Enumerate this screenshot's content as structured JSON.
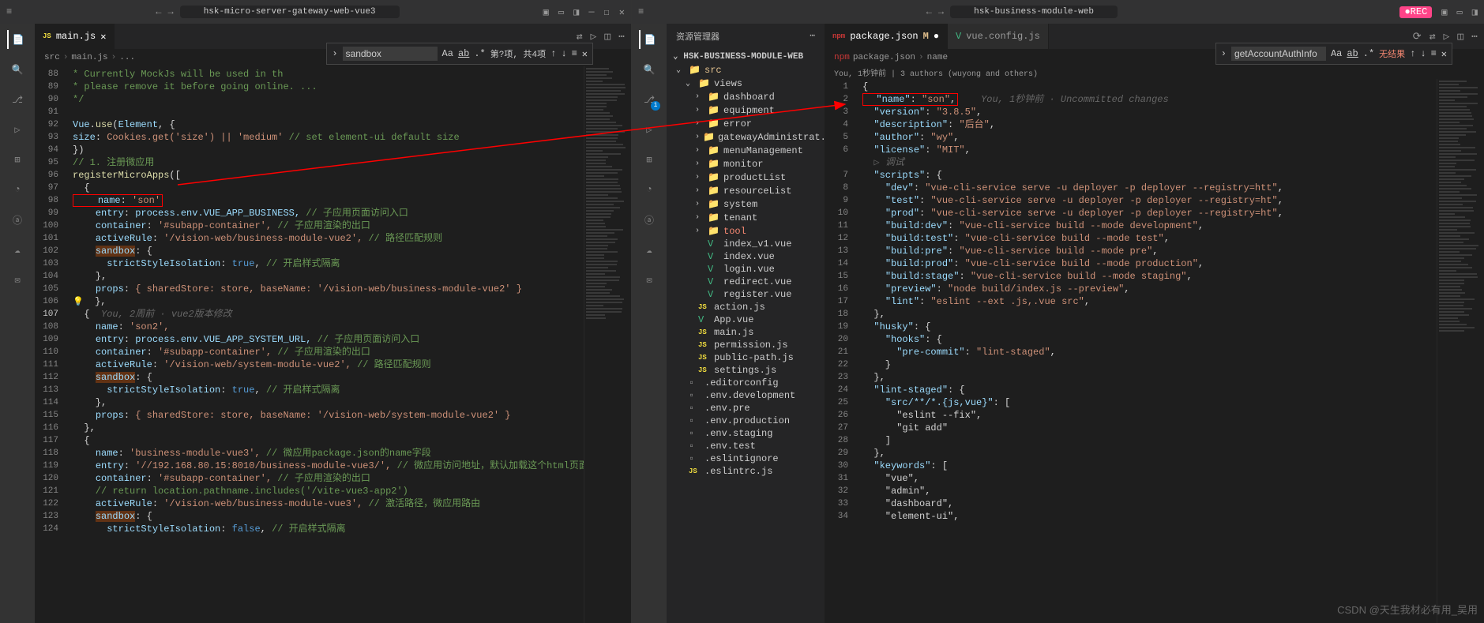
{
  "left": {
    "title": "hsk-micro-server-gateway-web-vue3",
    "tabs": [
      {
        "label": "main.js",
        "icon": "JS",
        "active": true
      }
    ],
    "breadcrumb": [
      "src",
      "main.js",
      "..."
    ],
    "search": {
      "value": "sandbox",
      "info": "第?项, 共4项"
    },
    "code_start_line": 88,
    "code": [
      {
        "n": 88,
        "t": "comment",
        "c": "* Currently MockJs will be used in th"
      },
      {
        "n": 89,
        "t": "comment",
        "c": "* please remove it before going online. ..."
      },
      {
        "n": 90,
        "t": "comment",
        "c": "*/"
      },
      {
        "n": 91,
        "t": "blank",
        "c": ""
      },
      {
        "n": 92,
        "t": "code",
        "c": [
          "Vue",
          ".",
          "use",
          "(",
          "Element",
          ", {"
        ]
      },
      {
        "n": 93,
        "t": "kv",
        "k": "size",
        "v": "Cookies.get('size') || 'medium'",
        "cm": "// set element-ui default size"
      },
      {
        "n": 94,
        "t": "punct",
        "c": "})"
      },
      {
        "n": 95,
        "t": "comment",
        "c": "// 1. 注册微应用"
      },
      {
        "n": 96,
        "t": "call",
        "c": "registerMicroApps(["
      },
      {
        "n": 97,
        "t": "punct",
        "c": "  {",
        "hl": false
      },
      {
        "n": 98,
        "t": "kv",
        "k": "    name",
        "v": "'son'",
        "hl": true
      },
      {
        "n": 99,
        "t": "kv",
        "k": "    entry",
        "v": "process.env.VUE_APP_BUSINESS,",
        "cm": "// 子应用页面访问入口"
      },
      {
        "n": 100,
        "t": "kv",
        "k": "    container",
        "v": "'#subapp-container',",
        "cm": "// 子应用渲染的出口"
      },
      {
        "n": 101,
        "t": "kv",
        "k": "    activeRule",
        "v": "'/vision-web/business-module-vue2',",
        "cm": "// 路径匹配规则"
      },
      {
        "n": 102,
        "t": "kv",
        "k": "    sandbox",
        "v": "{",
        "hlbg": true
      },
      {
        "n": 103,
        "t": "kv",
        "k": "      strictStyleIsolation",
        "v": "true,",
        "cm": "// 开启样式隔离"
      },
      {
        "n": 104,
        "t": "punct",
        "c": "    },"
      },
      {
        "n": 105,
        "t": "kv",
        "k": "    props",
        "v": "{ sharedStore: store, baseName: '/vision-web/business-module-vue2' }"
      },
      {
        "n": 106,
        "t": "punct",
        "c": "  },",
        "bulb": true
      },
      {
        "n": 107,
        "t": "blank",
        "c": "  {",
        "ghost": "You, 2周前 · vue2版本修改",
        "active": true
      },
      {
        "n": 108,
        "t": "kv",
        "k": "    name",
        "v": "'son2',"
      },
      {
        "n": 109,
        "t": "kv",
        "k": "    entry",
        "v": "process.env.VUE_APP_SYSTEM_URL,",
        "cm": "// 子应用页面访问入口"
      },
      {
        "n": 110,
        "t": "kv",
        "k": "    container",
        "v": "'#subapp-container',",
        "cm": "// 子应用渲染的出口"
      },
      {
        "n": 111,
        "t": "kv",
        "k": "    activeRule",
        "v": "'/vision-web/system-module-vue2',",
        "cm": "// 路径匹配规则"
      },
      {
        "n": 112,
        "t": "kv",
        "k": "    sandbox",
        "v": "{",
        "hlbg": true
      },
      {
        "n": 113,
        "t": "kv",
        "k": "      strictStyleIsolation",
        "v": "true,",
        "cm": "// 开启样式隔离"
      },
      {
        "n": 114,
        "t": "punct",
        "c": "    },"
      },
      {
        "n": 115,
        "t": "kv",
        "k": "    props",
        "v": "{ sharedStore: store, baseName: '/vision-web/system-module-vue2' }"
      },
      {
        "n": 116,
        "t": "punct",
        "c": "  },"
      },
      {
        "n": 117,
        "t": "punct",
        "c": "  {"
      },
      {
        "n": 118,
        "t": "kv",
        "k": "    name",
        "v": "'business-module-vue3',",
        "cm": "// 微应用package.json的name字段"
      },
      {
        "n": 119,
        "t": "kv",
        "k": "    entry",
        "v": "'//192.168.80.15:8010/business-module-vue3/',",
        "cm": "// 微应用访问地址，默认加载这个html页面并"
      },
      {
        "n": 120,
        "t": "kv",
        "k": "    container",
        "v": "'#subapp-container',",
        "cm": "// 子应用渲染的出口"
      },
      {
        "n": 121,
        "t": "comment",
        "c": "    // return location.pathname.includes('/vite-vue3-app2')"
      },
      {
        "n": 122,
        "t": "kv",
        "k": "    activeRule",
        "v": "'/vision-web/business-module-vue3',",
        "cm": "// 激活路径，微应用路由"
      },
      {
        "n": 123,
        "t": "kv",
        "k": "    sandbox",
        "v": "{",
        "hlbg": true
      },
      {
        "n": 124,
        "t": "kv",
        "k": "      strictStyleIsolation",
        "v": "false,",
        "cm": "// 开启样式隔离"
      }
    ]
  },
  "right": {
    "title": "hsk-business-module-web",
    "sidebar_header": "资源管理器",
    "project": "HSK-BUSINESS-MODULE-WEB",
    "tree": [
      {
        "name": "src",
        "type": "folder",
        "depth": 0,
        "open": true,
        "mod": true
      },
      {
        "name": "views",
        "type": "folder",
        "depth": 1,
        "open": true
      },
      {
        "name": "dashboard",
        "type": "folder",
        "depth": 2
      },
      {
        "name": "equipment",
        "type": "folder",
        "depth": 2
      },
      {
        "name": "error",
        "type": "folder",
        "depth": 2
      },
      {
        "name": "gatewayAdministrat...",
        "type": "folder",
        "depth": 2
      },
      {
        "name": "menuManagement",
        "type": "folder",
        "depth": 2
      },
      {
        "name": "monitor",
        "type": "folder",
        "depth": 2
      },
      {
        "name": "productList",
        "type": "folder",
        "depth": 2
      },
      {
        "name": "resourceList",
        "type": "folder",
        "depth": 2
      },
      {
        "name": "system",
        "type": "folder",
        "depth": 2
      },
      {
        "name": "tenant",
        "type": "folder",
        "depth": 2
      },
      {
        "name": "tool",
        "type": "folder",
        "depth": 2,
        "red": true
      },
      {
        "name": "index_v1.vue",
        "type": "vue",
        "depth": 2
      },
      {
        "name": "index.vue",
        "type": "vue",
        "depth": 2
      },
      {
        "name": "login.vue",
        "type": "vue",
        "depth": 2
      },
      {
        "name": "redirect.vue",
        "type": "vue",
        "depth": 2
      },
      {
        "name": "register.vue",
        "type": "vue",
        "depth": 2
      },
      {
        "name": "action.js",
        "type": "js",
        "depth": 1
      },
      {
        "name": "App.vue",
        "type": "vue",
        "depth": 1
      },
      {
        "name": "main.js",
        "type": "js",
        "depth": 1
      },
      {
        "name": "permission.js",
        "type": "js",
        "depth": 1
      },
      {
        "name": "public-path.js",
        "type": "js",
        "depth": 1
      },
      {
        "name": "settings.js",
        "type": "js",
        "depth": 1
      },
      {
        "name": ".editorconfig",
        "type": "file",
        "depth": 0
      },
      {
        "name": ".env.development",
        "type": "file",
        "depth": 0
      },
      {
        "name": ".env.pre",
        "type": "file",
        "depth": 0
      },
      {
        "name": ".env.production",
        "type": "file",
        "depth": 0
      },
      {
        "name": ".env.staging",
        "type": "file",
        "depth": 0
      },
      {
        "name": ".env.test",
        "type": "file",
        "depth": 0
      },
      {
        "name": ".eslintignore",
        "type": "file",
        "depth": 0
      },
      {
        "name": ".eslintrc.js",
        "type": "js",
        "depth": 0
      }
    ],
    "tabs": [
      {
        "label": "package.json",
        "icon": "npm",
        "mod": "M",
        "active": true
      },
      {
        "label": "vue.config.js",
        "icon": "vue"
      }
    ],
    "breadcrumb": [
      "package.json",
      "name"
    ],
    "search": {
      "value": "getAccountAuthInfo",
      "info": "无结果"
    },
    "codelens": "You, 1秒钟前 | 3 authors (wuyong and others)",
    "code": [
      {
        "n": 1,
        "c": "{"
      },
      {
        "n": 2,
        "k": "name",
        "v": "son",
        "hl": true,
        "ghost": "You, 1秒钟前 · Uncommitted changes"
      },
      {
        "n": 3,
        "k": "version",
        "v": "3.8.5"
      },
      {
        "n": 4,
        "k": "description",
        "v": "后台"
      },
      {
        "n": 5,
        "k": "author",
        "v": "wy"
      },
      {
        "n": 6,
        "k": "license",
        "v": "MIT"
      },
      {
        "n": 6.5,
        "raw": "  ▷ 调试"
      },
      {
        "n": 7,
        "k": "scripts",
        "obj": true
      },
      {
        "n": 8,
        "k": "dev",
        "v": "vue-cli-service serve -u deployer -p deployer --registry=htt",
        "d": 1
      },
      {
        "n": 9,
        "k": "test",
        "v": "vue-cli-service serve -u deployer -p deployer --registry=ht",
        "d": 1
      },
      {
        "n": 10,
        "k": "prod",
        "v": "vue-cli-service serve -u deployer -p deployer --registry=ht",
        "d": 1
      },
      {
        "n": 11,
        "k": "build:dev",
        "v": "vue-cli-service build --mode development",
        "d": 1
      },
      {
        "n": 12,
        "k": "build:test",
        "v": "vue-cli-service build --mode test",
        "d": 1
      },
      {
        "n": 13,
        "k": "build:pre",
        "v": "vue-cli-service build --mode pre",
        "d": 1
      },
      {
        "n": 14,
        "k": "build:prod",
        "v": "vue-cli-service build --mode production",
        "d": 1
      },
      {
        "n": 15,
        "k": "build:stage",
        "v": "vue-cli-service build --mode staging",
        "d": 1
      },
      {
        "n": 16,
        "k": "preview",
        "v": "node build/index.js --preview",
        "d": 1
      },
      {
        "n": 17,
        "k": "lint",
        "v": "eslint --ext .js,.vue src",
        "d": 1
      },
      {
        "n": 18,
        "c": "  },"
      },
      {
        "n": 19,
        "k": "husky",
        "obj": true
      },
      {
        "n": 20,
        "k": "hooks",
        "obj": true,
        "d": 1
      },
      {
        "n": 21,
        "k": "pre-commit",
        "v": "lint-staged",
        "d": 2
      },
      {
        "n": 22,
        "c": "    }"
      },
      {
        "n": 23,
        "c": "  },"
      },
      {
        "n": 24,
        "k": "lint-staged",
        "obj": true
      },
      {
        "n": 25,
        "k": "src/**/*.{js,vue}",
        "arr": true,
        "d": 1
      },
      {
        "n": 26,
        "c": "      \"eslint --fix\","
      },
      {
        "n": 27,
        "c": "      \"git add\""
      },
      {
        "n": 28,
        "c": "    ]"
      },
      {
        "n": 29,
        "c": "  },"
      },
      {
        "n": 30,
        "k": "keywords",
        "arr": true
      },
      {
        "n": 31,
        "c": "    \"vue\","
      },
      {
        "n": 32,
        "c": "    \"admin\","
      },
      {
        "n": 33,
        "c": "    \"dashboard\","
      },
      {
        "n": 34,
        "c": "    \"element-ui\","
      }
    ]
  },
  "watermark": "CSDN @天生我材必有用_吴用"
}
